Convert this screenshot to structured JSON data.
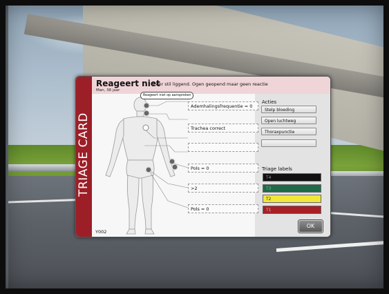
{
  "card": {
    "spine_label": "TRIAGE CARD",
    "title": "Reageert niet",
    "description": "Zeer stil liggend. Ogen geopend maar geen reactie",
    "patient": "Man, 38 jaar",
    "tooltip": "Reageert niet op aanspreken",
    "id": "Y002",
    "fields": [
      {
        "text": "Ademhalingsfrequentie = 0"
      },
      {
        "text": "Trachea correct"
      },
      {
        "text": ""
      },
      {
        "text": "Pols = 0"
      },
      {
        "text": ">2"
      },
      {
        "text": "Pols = 0"
      }
    ]
  },
  "actions": {
    "heading": "Acties",
    "buttons": [
      {
        "label": "Stelp bloeding"
      },
      {
        "label": "Open luchtweg"
      },
      {
        "label": "Thoraxpunctie"
      },
      {
        "label": ""
      }
    ]
  },
  "triage": {
    "heading": "Triage labels",
    "labels": [
      {
        "label": "T4",
        "color": "#111111",
        "text_color": "#9a9a9a"
      },
      {
        "label": "T3",
        "color": "#1f6b47",
        "text_color": "#7fb79a"
      },
      {
        "label": "T2",
        "color": "#f2e63a",
        "text_color": "#333333"
      },
      {
        "label": "T1",
        "color": "#a82025",
        "text_color": "#e6b0b2"
      }
    ]
  },
  "ok_label": "OK",
  "colors": {
    "spine": "#9c1e27",
    "header": "#f0d5d8",
    "panel": "#e3e3e3"
  }
}
